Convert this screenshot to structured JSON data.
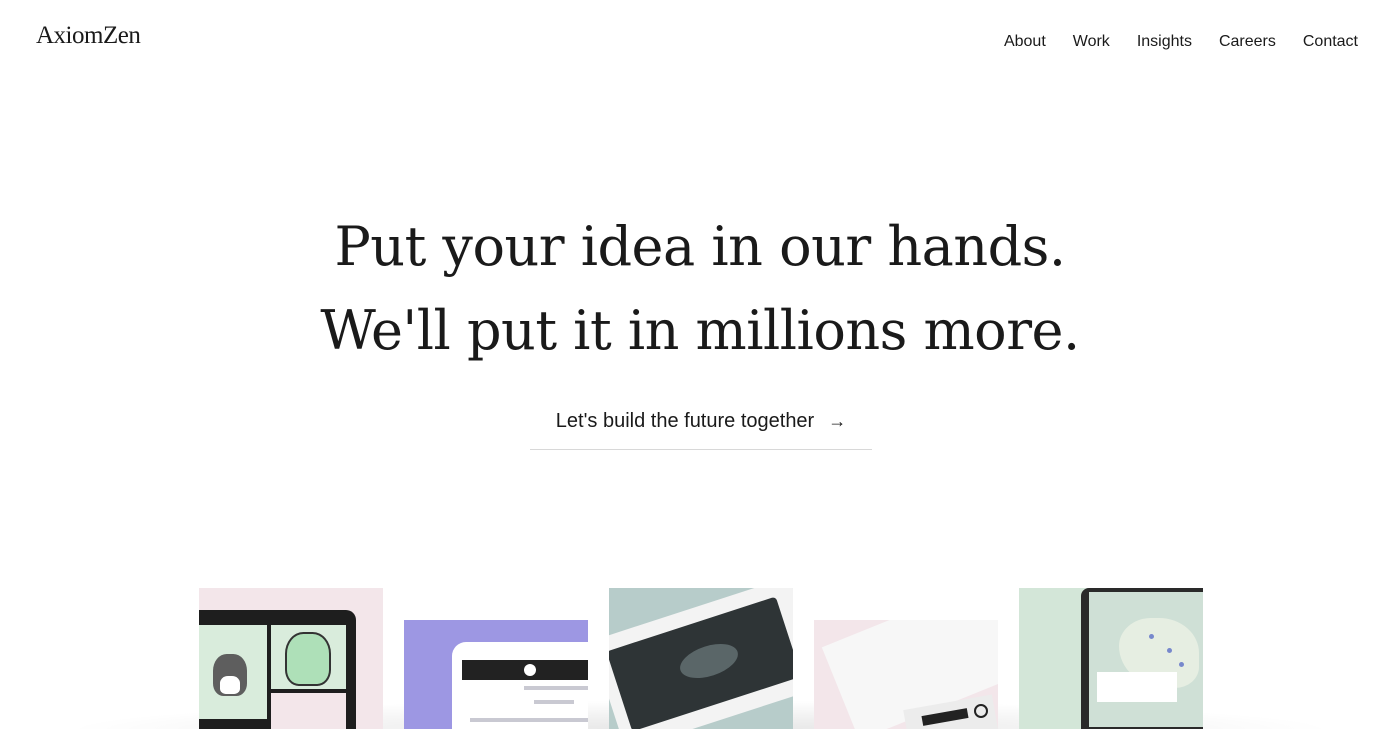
{
  "header": {
    "logo": "AxiomZen",
    "nav": [
      "About",
      "Work",
      "Insights",
      "Careers",
      "Contact"
    ]
  },
  "hero": {
    "line1": "Put your idea in our hands.",
    "line2": "We'll put it in millions more.",
    "cta": "Let's build the future together",
    "cta_icon": "arrow-right-icon"
  },
  "colors": {
    "text": "#1a1a1a",
    "background": "#ffffff",
    "thumb_pink": "#f3e6ea",
    "thumb_purple": "#9d97e3",
    "thumb_teal": "#b7ccca",
    "thumb_green": "#d3e6d8"
  }
}
